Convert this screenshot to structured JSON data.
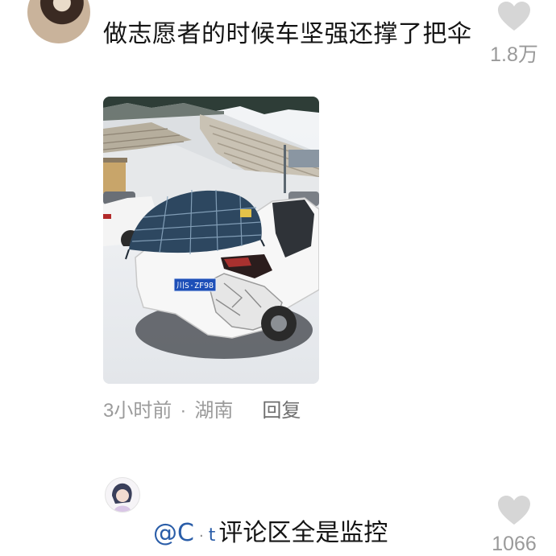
{
  "comments": [
    {
      "text": "做志愿者的时候车坚强还撑了把伞",
      "like_count": "1.8万",
      "time": "3小时前",
      "location": "湖南",
      "reply_label": "回复",
      "image": {
        "plate": "川S·ZF98"
      }
    },
    {
      "mention": "@C",
      "mention_tail": "t",
      "text": "评论区全是监控",
      "like_count": "1066"
    }
  ],
  "meta_separator": "·",
  "colors": {
    "heart": "#d6d6d6",
    "count": "#9a9a9a",
    "mention": "#2a5da8"
  },
  "icons": {
    "like": "heart-icon"
  }
}
